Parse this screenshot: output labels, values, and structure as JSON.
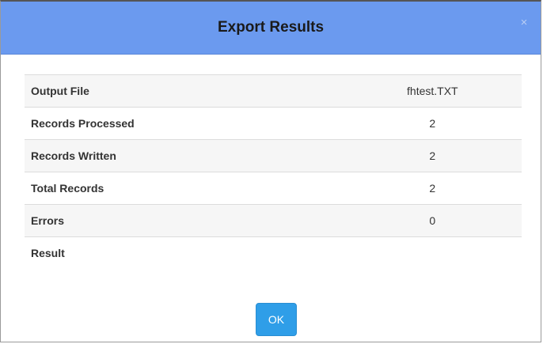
{
  "dialog": {
    "title": "Export Results",
    "close_symbol": "×",
    "ok_label": "OK"
  },
  "results": {
    "rows": [
      {
        "label": "Output File",
        "value": "fhtest.TXT"
      },
      {
        "label": "Records Processed",
        "value": "2"
      },
      {
        "label": "Records Written",
        "value": "2"
      },
      {
        "label": "Total Records",
        "value": "2"
      },
      {
        "label": "Errors",
        "value": "0"
      },
      {
        "label": "Result",
        "value": ""
      }
    ]
  },
  "colors": {
    "header_bg": "#6b9aef",
    "ok_button_bg": "#2f9ee8"
  }
}
